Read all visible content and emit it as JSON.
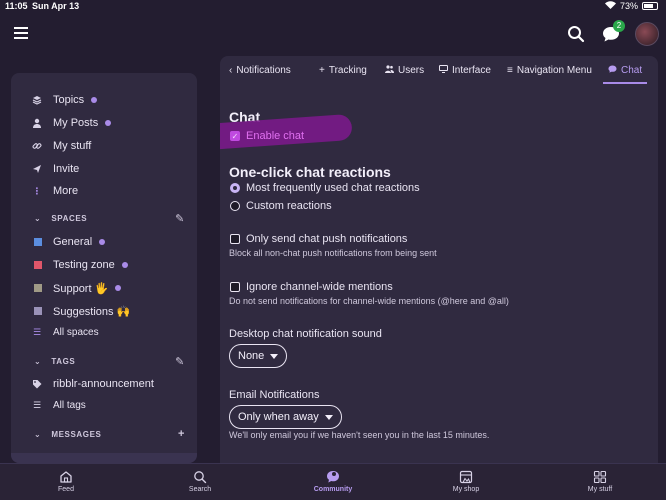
{
  "statusbar": {
    "time": "11:05",
    "date": "Sun Apr 13",
    "battery": "73%"
  },
  "header": {
    "chat_badge": "2"
  },
  "sidebar": {
    "items": [
      {
        "label": "Topics",
        "icon": "layers-icon",
        "dot": true
      },
      {
        "label": "My Posts",
        "icon": "user-icon",
        "dot": true
      },
      {
        "label": "My stuff",
        "icon": "link-icon",
        "dot": false
      },
      {
        "label": "Invite",
        "icon": "send-icon",
        "dot": false
      },
      {
        "label": "More",
        "icon": "more-vertical-icon",
        "dot": false
      }
    ],
    "spaces_heading": "SPACES",
    "spaces": [
      {
        "label": "General",
        "color": "#5b8ee0",
        "dot": true
      },
      {
        "label": "Testing zone",
        "color": "#e0566a",
        "dot": true
      },
      {
        "label": "Support 🖐",
        "color": "#a09a86",
        "dot": true
      },
      {
        "label": "Suggestions 🙌",
        "color": "#9a92b8",
        "dot": false
      }
    ],
    "all_spaces": "All spaces",
    "tags_heading": "TAGS",
    "tags": [
      {
        "label": "ribblr-announcement"
      }
    ],
    "all_tags": "All tags",
    "messages_heading": "MESSAGES"
  },
  "tabs": [
    {
      "label": "Notifications",
      "icon": "chevron-left-icon"
    },
    {
      "label": "Tracking",
      "icon": "plus-icon"
    },
    {
      "label": "Users",
      "icon": "users-icon"
    },
    {
      "label": "Interface",
      "icon": "monitor-icon"
    },
    {
      "label": "Navigation Menu",
      "icon": "menu-icon"
    },
    {
      "label": "Chat",
      "icon": "chat-icon",
      "active": true
    }
  ],
  "chat": {
    "heading": "Chat",
    "enable_label": "Enable chat",
    "enable_checked": true,
    "reactions_heading": "One-click chat reactions",
    "reaction_options": [
      "Most frequently used chat reactions",
      "Custom reactions"
    ],
    "reaction_selected": "Most frequently used chat reactions",
    "push_label": "Only send chat push notifications",
    "push_help": "Block all non-chat push notifications from being sent",
    "ignore_label": "Ignore channel-wide mentions",
    "ignore_help": "Do not send notifications for channel-wide mentions (@here and @all)",
    "sound_label": "Desktop chat notification sound",
    "sound_value": "None",
    "email_label": "Email Notifications",
    "email_value": "Only when away",
    "email_help": "We'll only email you if we haven't seen you in the last 15 minutes."
  },
  "bottom_nav": [
    {
      "label": "Feed",
      "icon": "home-icon"
    },
    {
      "label": "Search",
      "icon": "search-icon"
    },
    {
      "label": "Community",
      "icon": "community-icon",
      "active": true
    },
    {
      "label": "My shop",
      "icon": "shop-icon"
    },
    {
      "label": "My stuff",
      "icon": "grid-icon"
    }
  ],
  "colors": {
    "accent": "#a98be8",
    "highlight": "#7a1a8a",
    "background": "#231d30",
    "card": "#302a40"
  }
}
